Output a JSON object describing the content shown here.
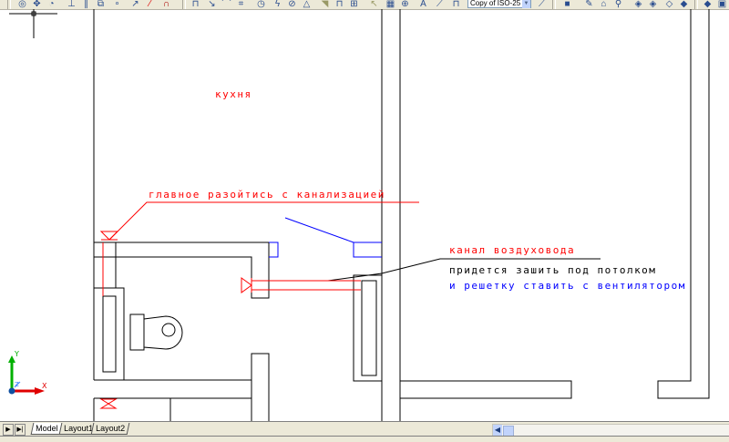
{
  "toolbar": {
    "icons": [
      "zoom-realtime-icon",
      "pan-icon",
      "orbit-icon",
      "perpendicular-icon",
      "parallel-icon",
      "insert-block-icon",
      "node-icon",
      "snap-from-icon",
      "snap-none-icon",
      "snap-settings-icon",
      "linear-dim-icon",
      "aligned-dim-icon",
      "arc-length-icon",
      "ordinate-dim-icon",
      "radius-dim-icon",
      "jogged-dim-icon",
      "diameter-dim-icon",
      "angular-dim-icon",
      "quick-dim-icon",
      "baseline-dim-icon",
      "continue-dim-icon",
      "quick-leader-icon",
      "tolerance-icon",
      "center-mark-icon",
      "dim-edit-icon",
      "dim-text-edit-icon",
      "dim-update-icon",
      "draw-order-icon",
      "properties-icon",
      "match-properties-icon",
      "layer-icon",
      "layer-prev-icon",
      "layer-match-icon",
      "layer-isolate-icon",
      "block-editor-icon",
      "xref-icon"
    ],
    "dim_style": "Copy of ISO-25"
  },
  "drawing": {
    "room_label": "кухня",
    "note_main": "главное разойтись с канализацией",
    "note_duct": "канал воздуховода",
    "note_ceiling": "придется зашить под потолком",
    "note_grille": "и решетку ставить с вентилятором",
    "ucs": {
      "x_label": "X",
      "y_label": "Y",
      "z_label": "Z"
    },
    "colors": {
      "red": "#ff0000",
      "blue": "#0000ff",
      "black": "#000000"
    }
  },
  "tabs": {
    "items": [
      {
        "label": "Model",
        "active": true
      },
      {
        "label": "Layout1",
        "active": false
      },
      {
        "label": "Layout2",
        "active": false
      }
    ]
  }
}
